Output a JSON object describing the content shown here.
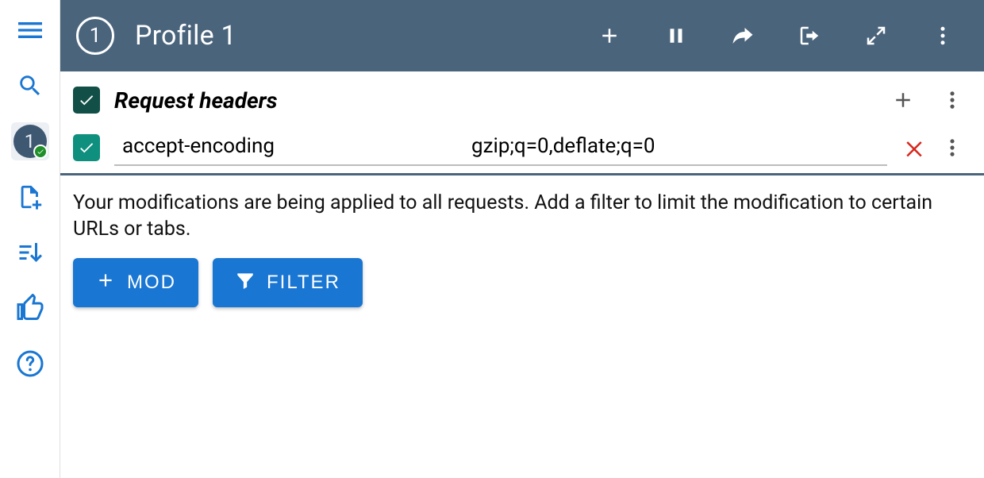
{
  "header": {
    "profile_number": "1",
    "title": "Profile 1"
  },
  "sidebar": {
    "active_profile_number": "1"
  },
  "section": {
    "title": "Request headers"
  },
  "headers": [
    {
      "name": "accept-encoding",
      "value": "gzip;q=0,deflate;q=0"
    }
  ],
  "hint": "Your modifications are being applied to all requests. Add a filter to limit the modification to certain URLs or tabs.",
  "buttons": {
    "mod": "MOD",
    "filter": "FILTER"
  }
}
